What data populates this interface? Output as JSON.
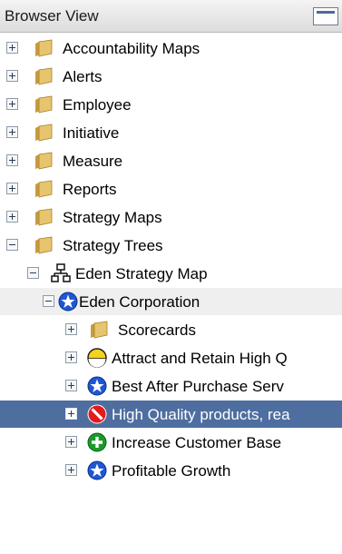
{
  "header": {
    "title": "Browser View",
    "toggle_icon": "panel-toggle-icon"
  },
  "tree": [
    {
      "label": "Accountability Maps",
      "icon": "folder-icon",
      "expander": "plus-icon"
    },
    {
      "label": "Alerts",
      "icon": "folder-icon",
      "expander": "plus-icon"
    },
    {
      "label": "Employee",
      "icon": "folder-icon",
      "expander": "plus-icon"
    },
    {
      "label": "Initiative",
      "icon": "folder-icon",
      "expander": "plus-icon"
    },
    {
      "label": "Measure",
      "icon": "folder-icon",
      "expander": "plus-icon"
    },
    {
      "label": "Reports",
      "icon": "folder-icon",
      "expander": "plus-icon"
    },
    {
      "label": "Strategy Maps",
      "icon": "folder-icon",
      "expander": "plus-icon"
    },
    {
      "label": "Strategy Trees",
      "icon": "folder-icon",
      "expander": "minus-icon"
    },
    {
      "label": "Eden Strategy Map",
      "icon": "hierarchy-icon",
      "expander": "minus-icon"
    },
    {
      "label": "Eden Corporation",
      "icon": "blue-star-status-icon",
      "expander": "minus-icon"
    },
    {
      "label": "Scorecards",
      "icon": "folder-icon",
      "expander": "plus-icon"
    },
    {
      "label": "Attract and Retain High Q",
      "icon": "yellow-status-icon",
      "expander": "plus-icon"
    },
    {
      "label": "Best After Purchase Serv",
      "icon": "blue-star-status-icon",
      "expander": "plus-icon"
    },
    {
      "label": "High Quality products, rea",
      "icon": "red-no-status-icon",
      "expander": "plus-icon",
      "selected": true
    },
    {
      "label": "Increase Customer Base",
      "icon": "green-plus-status-icon",
      "expander": "plus-icon"
    },
    {
      "label": "Profitable Growth",
      "icon": "blue-star-status-icon",
      "expander": "plus-icon"
    }
  ],
  "colors": {
    "selection": "#4e6ea0",
    "folder": "#e0b85a",
    "status_blue": "#1f56d6",
    "status_red": "#e21b1b",
    "status_green": "#1b9a2b",
    "status_yellow": "#f6d21a"
  }
}
